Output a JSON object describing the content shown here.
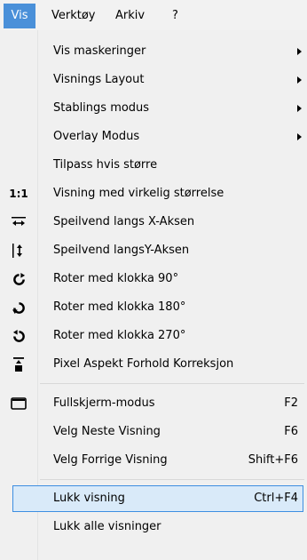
{
  "menubar": {
    "items": [
      {
        "label": "Vis"
      },
      {
        "label": "Verktøy"
      },
      {
        "label": "Arkiv"
      },
      {
        "label": "?"
      }
    ]
  },
  "menu": {
    "items": [
      {
        "label": "Vis maskeringer",
        "submenu": true
      },
      {
        "label": "Visnings Layout",
        "submenu": true
      },
      {
        "label": "Stablings modus",
        "submenu": true
      },
      {
        "label": "Overlay Modus",
        "submenu": true
      },
      {
        "label": "Tilpass hvis større"
      },
      {
        "label": "Visning med virkelig størrelse",
        "icon": "actual-size-icon",
        "icon_text": "1:1"
      },
      {
        "label": "Speilvend langs X-Aksen",
        "icon": "mirror-x-icon"
      },
      {
        "label": "Speilvend langsY-Aksen",
        "icon": "mirror-y-icon"
      },
      {
        "label": "Roter med klokka 90°",
        "icon": "rotate-90-icon"
      },
      {
        "label": "Roter med klokka 180°",
        "icon": "rotate-180-icon"
      },
      {
        "label": "Roter med klokka 270°",
        "icon": "rotate-270-icon"
      },
      {
        "label": "Pixel Aspekt Forhold Korreksjon",
        "icon": "pixel-aspect-icon"
      },
      {
        "label": "Fullskjerm-modus",
        "shortcut": "F2",
        "icon": "fullscreen-icon"
      },
      {
        "label": "Velg Neste Visning",
        "shortcut": "F6"
      },
      {
        "label": "Velg Forrige Visning",
        "shortcut": "Shift+F6"
      },
      {
        "label": "Lukk visning",
        "shortcut": "Ctrl+F4",
        "highlighted": true
      },
      {
        "label": "Lukk alle visninger"
      }
    ]
  },
  "colors": {
    "active_menu_bg": "#4a90d9",
    "highlight_bg": "#d9eaf9",
    "highlight_border": "#3d8ee1"
  }
}
